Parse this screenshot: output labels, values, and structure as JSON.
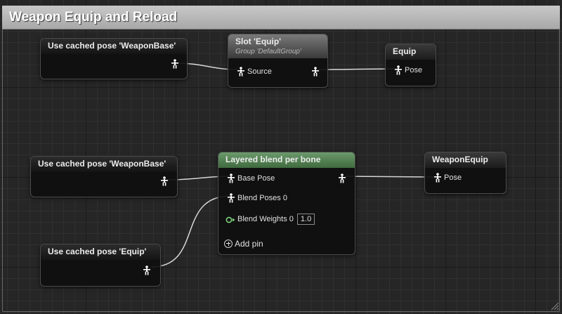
{
  "comment": {
    "title": "Weapon Equip and Reload"
  },
  "nodes": {
    "cache1": {
      "title": "Use cached pose 'WeaponBase'"
    },
    "slot": {
      "title": "Slot 'Equip'",
      "subtitle": "Group 'DefaultGroup'",
      "input_label": "Source"
    },
    "equip": {
      "title": "Equip",
      "input_label": "Pose"
    },
    "cache2": {
      "title": "Use cached pose 'WeaponBase'"
    },
    "blend": {
      "title": "Layered blend per bone",
      "base_pose": "Base Pose",
      "blend_poses": "Blend Poses 0",
      "blend_weights": "Blend Weights 0",
      "blend_weight_value": "1.0",
      "add_pin": "Add pin"
    },
    "weapon_equip": {
      "title": "WeaponEquip",
      "input_label": "Pose"
    },
    "cache3": {
      "title": "Use cached pose 'Equip'"
    }
  },
  "colors": {
    "blend_header": "#5b8a5b",
    "float_pin": "#7fd27f",
    "wire": "#d8d8d8"
  },
  "icons": {
    "pose_pin": "pose-figure-icon",
    "float_pin": "float-pin-icon",
    "add": "add-pin-icon"
  }
}
